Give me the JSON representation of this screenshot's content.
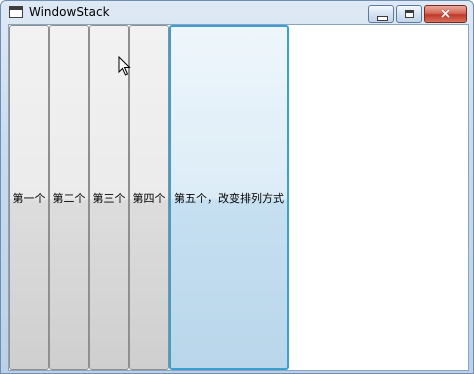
{
  "window": {
    "title": "WindowStack",
    "controls": {
      "minimize": "minimize",
      "maximize": "maximize",
      "close": "×"
    }
  },
  "stack_items": [
    {
      "label": "第一个"
    },
    {
      "label": "第二个"
    },
    {
      "label": "第三个"
    },
    {
      "label": "第四个"
    },
    {
      "label": "第五个，改变排列方式"
    }
  ],
  "colors": {
    "focus_border": "#3c9fd3",
    "button_face": "#e6e6e6",
    "close_button": "#c0392b"
  },
  "icons": [
    "app-window-icon",
    "minimize-icon",
    "maximize-icon",
    "close-icon",
    "mouse-cursor-icon"
  ]
}
